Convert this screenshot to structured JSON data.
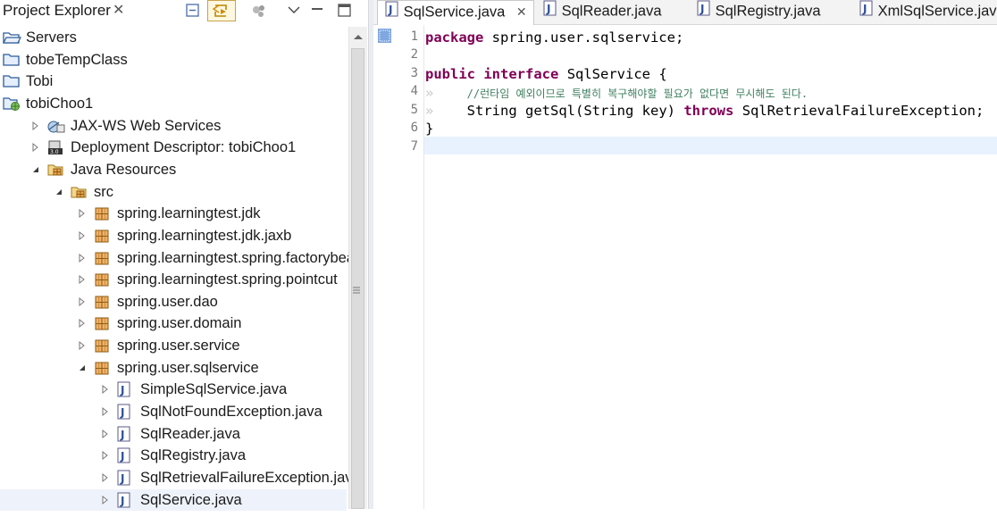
{
  "explorer": {
    "title": "Project Explorer",
    "close_glyph": "✕",
    "tree": [
      {
        "label": "Servers",
        "icon": "folder-open-icon",
        "depth": 0,
        "twisty": "none"
      },
      {
        "label": "tobeTempClass",
        "icon": "project-folder-icon",
        "depth": 0,
        "twisty": "none"
      },
      {
        "label": "Tobi",
        "icon": "project-folder-icon",
        "depth": 0,
        "twisty": "none"
      },
      {
        "label": "tobiChoo1",
        "icon": "web-project-icon",
        "depth": 0,
        "twisty": "none"
      },
      {
        "label": "JAX-WS Web Services",
        "icon": "web-services-icon",
        "depth": 1,
        "twisty": "collapsed"
      },
      {
        "label": "Deployment Descriptor: tobiChoo1",
        "icon": "deployment-descriptor-icon",
        "depth": 1,
        "twisty": "collapsed"
      },
      {
        "label": "Java Resources",
        "icon": "java-resources-icon",
        "depth": 1,
        "twisty": "expanded"
      },
      {
        "label": "src",
        "icon": "source-folder-icon",
        "depth": 2,
        "twisty": "expanded"
      },
      {
        "label": "spring.learningtest.jdk",
        "icon": "package-icon",
        "depth": 3,
        "twisty": "collapsed"
      },
      {
        "label": "spring.learningtest.jdk.jaxb",
        "icon": "package-icon",
        "depth": 3,
        "twisty": "collapsed"
      },
      {
        "label": "spring.learningtest.spring.factorybean",
        "icon": "package-icon",
        "depth": 3,
        "twisty": "collapsed"
      },
      {
        "label": "spring.learningtest.spring.pointcut",
        "icon": "package-icon",
        "depth": 3,
        "twisty": "collapsed"
      },
      {
        "label": "spring.user.dao",
        "icon": "package-icon",
        "depth": 3,
        "twisty": "collapsed"
      },
      {
        "label": "spring.user.domain",
        "icon": "package-icon",
        "depth": 3,
        "twisty": "collapsed"
      },
      {
        "label": "spring.user.service",
        "icon": "package-icon",
        "depth": 3,
        "twisty": "collapsed"
      },
      {
        "label": "spring.user.sqlservice",
        "icon": "package-icon",
        "depth": 3,
        "twisty": "expanded"
      },
      {
        "label": "SimpleSqlService.java",
        "icon": "java-file-icon",
        "depth": 4,
        "twisty": "collapsed"
      },
      {
        "label": "SqlNotFoundException.java",
        "icon": "java-file-icon",
        "depth": 4,
        "twisty": "collapsed"
      },
      {
        "label": "SqlReader.java",
        "icon": "java-file-icon",
        "depth": 4,
        "twisty": "collapsed"
      },
      {
        "label": "SqlRegistry.java",
        "icon": "java-file-icon",
        "depth": 4,
        "twisty": "collapsed"
      },
      {
        "label": "SqlRetrievalFailureException.java",
        "icon": "java-file-icon",
        "depth": 4,
        "twisty": "collapsed"
      },
      {
        "label": "SqlService.java",
        "icon": "java-file-icon",
        "depth": 4,
        "twisty": "collapsed",
        "selected": true
      }
    ]
  },
  "editor": {
    "tabs": [
      {
        "label": "SqlService.java",
        "active": true,
        "close_glyph": "✕"
      },
      {
        "label": "SqlReader.java",
        "active": false
      },
      {
        "label": "SqlRegistry.java",
        "active": false
      },
      {
        "label": "XmlSqlService.java",
        "active": false
      }
    ],
    "line_numbers": [
      "1",
      "2",
      "3",
      "4",
      "5",
      "6",
      "7"
    ],
    "code": {
      "l1_kw": "package",
      "l1_rest": "spring.user.sqlservice;",
      "l3_kw1": "public",
      "l3_kw2": "interface",
      "l3_rest": "SqlService {",
      "l4_comment": "//런타임 예외이므로 특별히 복구해야할 필요가 없다면 무시해도 된다.",
      "l5_a": "String",
      "l5_b": "getSql(String key)",
      "l5_kw": "throws",
      "l5_c": "SqlRetrievalFailureException;",
      "l6": "}"
    },
    "whitespace_glyph": "»"
  },
  "colors": {
    "keyword": "#7f0055",
    "comment": "#3f7f5f",
    "current_line": "#e8f2fe",
    "selection": "#eef3fb"
  }
}
